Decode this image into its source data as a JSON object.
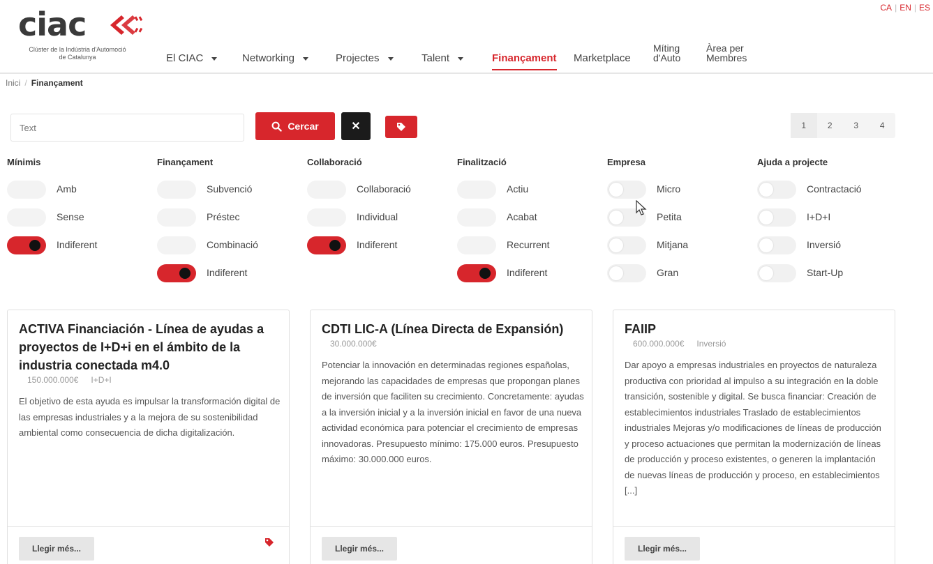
{
  "brand": {
    "logo_text": "ciac",
    "logo_subtitle_1": "Clúster de la Indústria d'Automoció",
    "logo_subtitle_2": "de Catalunya",
    "accent_color": "#d7262c"
  },
  "languages": [
    "CA",
    "EN",
    "ES"
  ],
  "nav": {
    "items": [
      {
        "label": "El CIAC",
        "dropdown": true
      },
      {
        "label": "Networking",
        "dropdown": true
      },
      {
        "label": "Projectes",
        "dropdown": true
      },
      {
        "label": "Talent",
        "dropdown": true
      },
      {
        "label": "Finançament",
        "dropdown": false,
        "active": true
      },
      {
        "label": "Marketplace",
        "dropdown": false
      }
    ],
    "miting_line1": "Míting",
    "miting_line2": "d'Auto",
    "area_line1": "Àrea per",
    "area_line2": "Membres"
  },
  "breadcrumb": {
    "home": "Inici",
    "separator": "/",
    "current": "Finançament"
  },
  "search": {
    "placeholder": "Text",
    "value": "",
    "search_button_label": "Cercar",
    "clear_button_label": "✕"
  },
  "pagination": {
    "pages": [
      "1",
      "2",
      "3",
      "4"
    ],
    "current": "1"
  },
  "filters": [
    {
      "title": "Mínimis",
      "options": [
        {
          "label": "Amb",
          "state": "faint"
        },
        {
          "label": "Sense",
          "state": "faint"
        },
        {
          "label": "Indiferent",
          "state": "on"
        }
      ]
    },
    {
      "title": "Finançament",
      "options": [
        {
          "label": "Subvenció",
          "state": "faint"
        },
        {
          "label": "Préstec",
          "state": "faint"
        },
        {
          "label": "Combinació",
          "state": "faint"
        },
        {
          "label": "Indiferent",
          "state": "on"
        }
      ]
    },
    {
      "title": "Collaboració",
      "options": [
        {
          "label": "Collaboració",
          "state": "faint"
        },
        {
          "label": "Individual",
          "state": "faint"
        },
        {
          "label": "Indiferent",
          "state": "on"
        }
      ]
    },
    {
      "title": "Finalització",
      "options": [
        {
          "label": "Actiu",
          "state": "faint"
        },
        {
          "label": "Acabat",
          "state": "faint"
        },
        {
          "label": "Recurrent",
          "state": "faint"
        },
        {
          "label": "Indiferent",
          "state": "on"
        }
      ]
    },
    {
      "title": "Empresa",
      "options": [
        {
          "label": "Micro",
          "state": "off"
        },
        {
          "label": "Petita",
          "state": "off"
        },
        {
          "label": "Mitjana",
          "state": "off"
        },
        {
          "label": "Gran",
          "state": "off"
        }
      ]
    },
    {
      "title": "Ajuda a projecte",
      "options": [
        {
          "label": "Contractació",
          "state": "off"
        },
        {
          "label": "I+D+I",
          "state": "off"
        },
        {
          "label": "Inversió",
          "state": "off"
        },
        {
          "label": "Start-Up",
          "state": "off"
        }
      ]
    }
  ],
  "cards": [
    {
      "title": "ACTIVA Financiación - Línea de ayudas a proyectos de I+D+i en el ámbito de la industria conectada m4.0",
      "amount": "150.000.000€",
      "category": "I+D+I",
      "description": "El objetivo de esta ayuda es impulsar la transformación digital de las empresas industriales y a la mejora de su sostenibilidad ambiental como consecuencia de dicha digitalización.",
      "button_label": "Llegir més...",
      "has_tag": true
    },
    {
      "title": "CDTI LIC-A (Línea Directa de Expansión)",
      "amount": "30.000.000€",
      "category": "",
      "description": "Potenciar la innovación en determinadas regiones españolas, mejorando las capacidades de empresas que propongan planes de inversión que faciliten su crecimiento. Concretamente: ayudas a la inversión inicial y a la inversión inicial en favor de una nueva actividad económica para potenciar el crecimiento de empresas innovadoras. Presupuesto mínimo: 175.000 euros. Presupuesto máximo: 30.000.000 euros.",
      "button_label": "Llegir més...",
      "has_tag": false
    },
    {
      "title": "FAIIP",
      "amount": "600.000.000€",
      "category": "Inversió",
      "description": "Dar apoyo a empresas industriales en proyectos de naturaleza productiva con prioridad al impulso a su integración en la doble transición, sostenible y digital. Se busca financiar: Creación de establecimientos industriales Traslado de establecimientos industriales Mejoras y/o modificaciones de líneas de producción y proceso actuaciones que permitan la modernización de líneas de producción y proceso existentes, o generen la implantación de nuevas líneas de producción y proceso, en establecimientos [...]",
      "button_label": "Llegir més...",
      "has_tag": false
    }
  ]
}
